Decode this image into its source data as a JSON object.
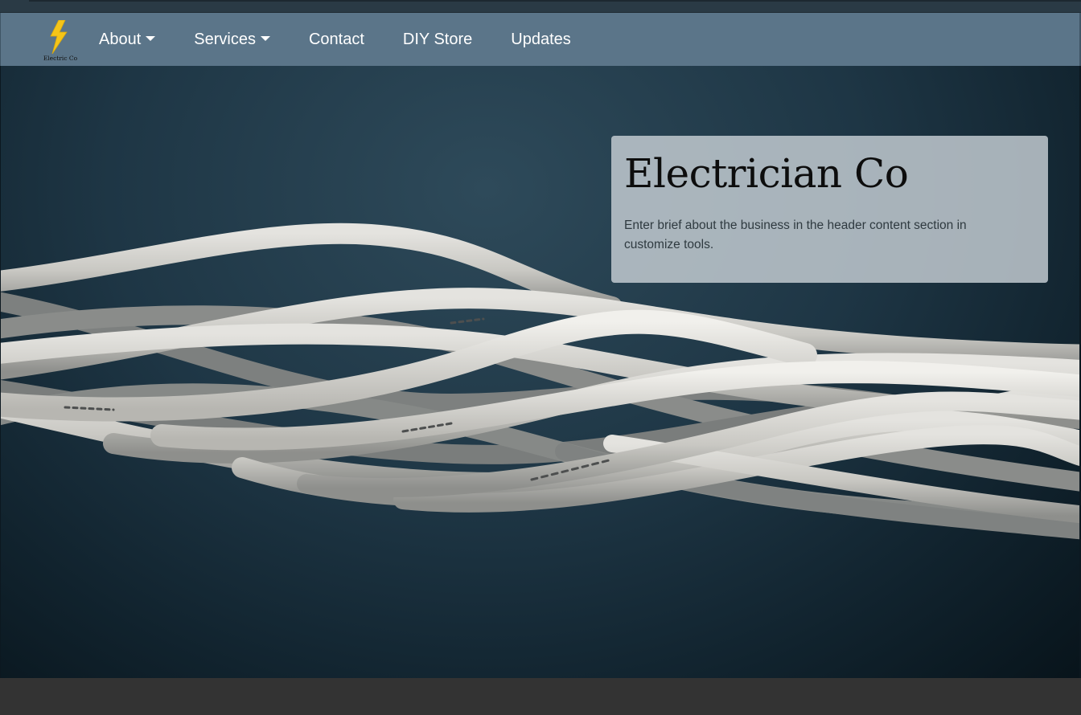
{
  "brand": {
    "logo_text": "Electric Co",
    "bolt_color": "#f5c518"
  },
  "nav": {
    "items": [
      {
        "label": "About",
        "has_dropdown": true
      },
      {
        "label": "Services",
        "has_dropdown": true
      },
      {
        "label": "Contact",
        "has_dropdown": false
      },
      {
        "label": "DIY Store",
        "has_dropdown": false
      },
      {
        "label": "Updates",
        "has_dropdown": false
      }
    ]
  },
  "hero": {
    "title": "Electrician Co",
    "description": "Enter brief about the business in the header content section in customize tools."
  },
  "colors": {
    "navbar": "#5b7589",
    "hero_bg": "#1e3645",
    "card_bg": "#c4ccd2",
    "footer": "#333333"
  }
}
